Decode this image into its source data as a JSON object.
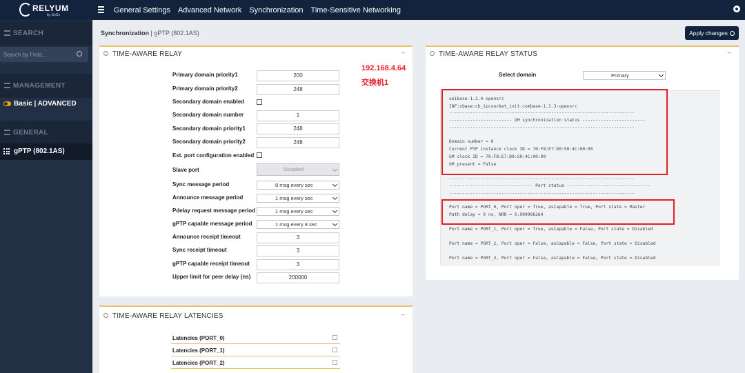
{
  "app": {
    "logo_text": "RELYUM",
    "logo_sub": "by SoCe"
  },
  "topnav": [
    "General Settings",
    "Advanced Network",
    "Synchronization",
    "Time-Sensitive Networking"
  ],
  "sidebar": {
    "search_head": "SEARCH",
    "search_placeholder": "Search by Field...",
    "management_head": "MANAGEMENT",
    "mode_basic": "Basic",
    "mode_sep": " | ",
    "mode_advanced": "ADVANCED",
    "general_head": "GENERAL",
    "active_item": "gPTP (802.1AS)"
  },
  "breadcrumb": {
    "section": "Synchronization",
    "sep": " | ",
    "page": "gPTP (802.1AS)"
  },
  "apply_label": "Apply changes",
  "relay": {
    "title": "TIME-AWARE RELAY",
    "rows": [
      {
        "label": "Primary domain priority1",
        "value": "200"
      },
      {
        "label": "Primary domain priority2",
        "value": "248"
      },
      {
        "label": "Secondary domain enabled",
        "value": ""
      },
      {
        "label": "Secondary domain number",
        "value": "1"
      },
      {
        "label": "Secondary domain priority1",
        "value": "248"
      },
      {
        "label": "Secondary domain priority2",
        "value": "248"
      },
      {
        "label": "Ext. port configuration enabled",
        "value": ""
      },
      {
        "label": "Slave port",
        "value": "Disabled"
      },
      {
        "label": "Sync message period",
        "value": "8 msg every sec"
      },
      {
        "label": "Announce message period",
        "value": "1 msg every sec"
      },
      {
        "label": "Pdelay request message period",
        "value": "1 msg every sec"
      },
      {
        "label": "gPTP capable message period",
        "value": "1 msg every 8 sec"
      },
      {
        "label": "Announce receipt timeout",
        "value": "3"
      },
      {
        "label": "Sync receipt timeout",
        "value": "3"
      },
      {
        "label": "gPTP capable receipt timeout",
        "value": "3"
      },
      {
        "label": "Upper limit for peer delay (ns)",
        "value": "200000"
      }
    ]
  },
  "annotation": {
    "ip": "192.168.4.64",
    "name": "交换机1"
  },
  "status": {
    "title": "TIME-AWARE RELAY STATUS",
    "select_label": "Select domain",
    "select_value": "Primary",
    "lines": [
      "unibase-1.1.4-opensrc",
      "INF:cbase:cb_ipcsocket_init:combase-1.1.3-opensrc",
      "-----------------------------------------------------------------------",
      "------------------------ GM synchronization status ------------------------",
      "-----------------------------------------------------------------------",
      "Domain number = 0",
      "Current PTP instance clock ID = 70:F8:E7:D0:50:4C:00:00",
      "GM clock ID = 70:F8:E7:D0:50:4C:00:00",
      "GM present = False",
      "-----------------------------------------------------------------------",
      "-------------------------------- Port status --------------------------------",
      "-----------------------------------------------------------------------",
      "Port name = PORT_0, Port oper = True, asCapable = True, Port state = Master",
      "Path delay = 0 ns, NRR = 0.999996264",
      "Port name = PORT_1, Port oper = True, asCapable = False, Port state = Disabled",
      "Port name = PORT_2, Port oper = False, asCapable = False, Port state = Disabled",
      "Port name = PORT_3, Port oper = False, asCapable = False, Port state = Disabled"
    ]
  },
  "latencies": {
    "title": "TIME-AWARE RELAY LATENCIES",
    "rows": [
      "Latencies (PORT_0)",
      "Latencies (PORT_1)",
      "Latencies (PORT_2)"
    ]
  },
  "colors": {
    "topbar": "#12233e",
    "sidebar": "#223046",
    "accent": "#e8c36a",
    "annotation": "#e8202a",
    "toggle": "#f0a500"
  },
  "icons": [
    "hamburger-icon",
    "gear-icon",
    "search-icon",
    "toggle-icon",
    "grid-icon",
    "gear-circle-icon",
    "check-circle-icon",
    "expand-icon"
  ]
}
